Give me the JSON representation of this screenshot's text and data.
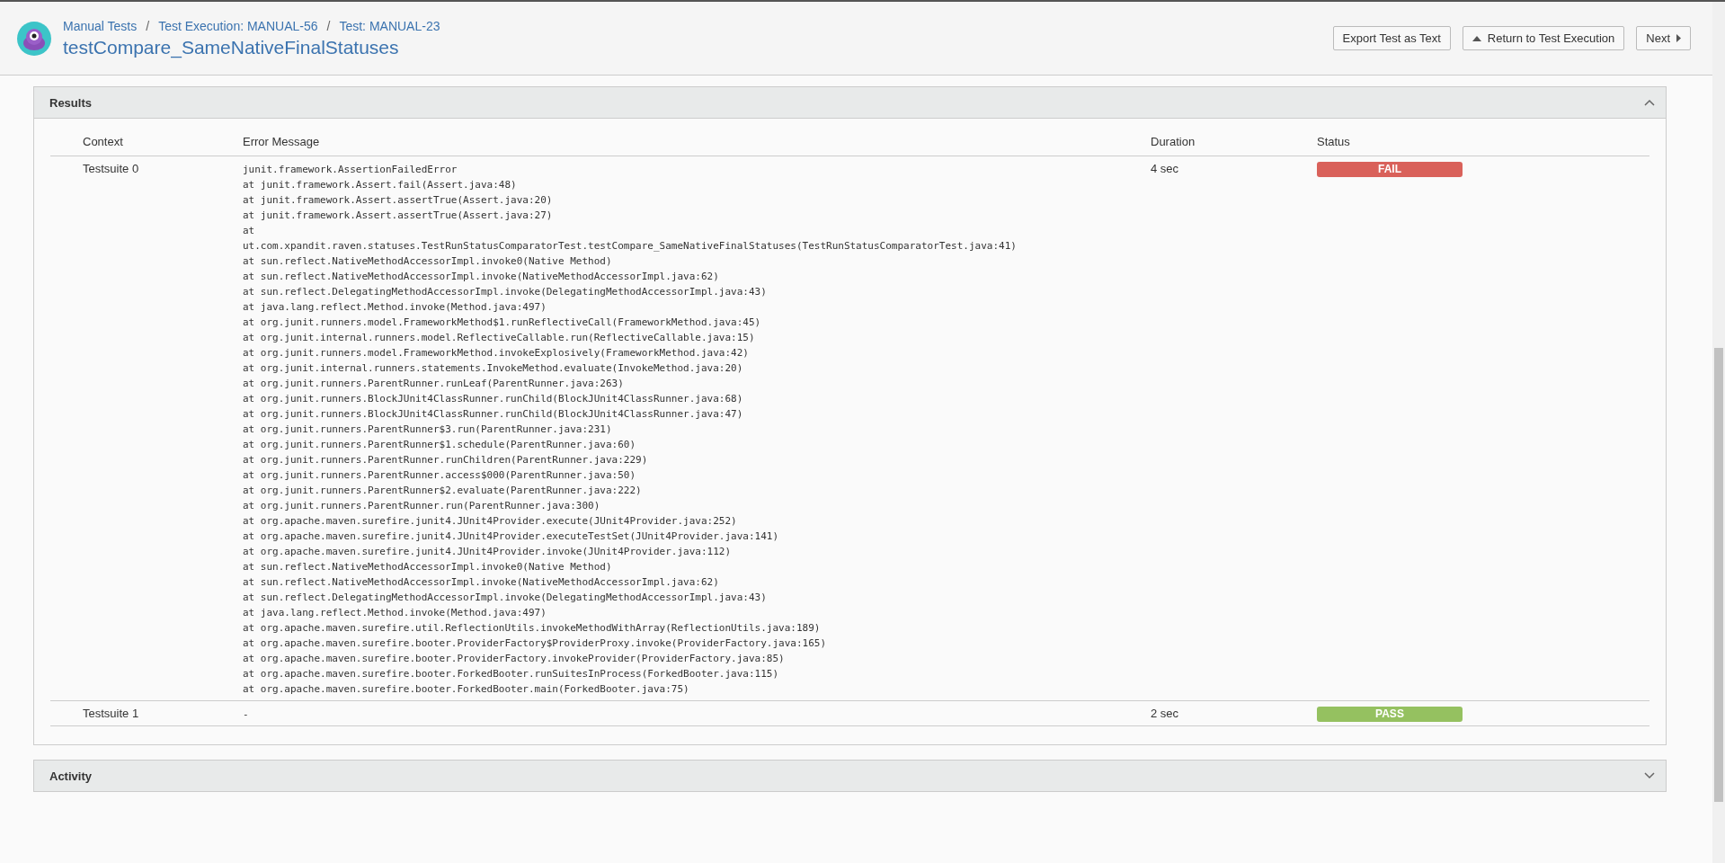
{
  "breadcrumbs": [
    "Manual Tests",
    "Test Execution: MANUAL-56",
    "Test: MANUAL-23"
  ],
  "breadcrumb_separator": "/",
  "title": "testCompare_SameNativeFinalStatuses",
  "buttons": [
    {
      "label": "Export Test as Text",
      "kind": "plain"
    },
    {
      "label": "Return to Test Execution",
      "kind": "up"
    },
    {
      "label": "Next",
      "kind": "next"
    }
  ],
  "results": {
    "title": "Results",
    "expanded": true,
    "columns": [
      "Context",
      "Error Message",
      "Duration",
      "Status"
    ],
    "rows": [
      {
        "context": "Testsuite 0",
        "error_lines": [
          "junit.framework.AssertionFailedError",
          "at junit.framework.Assert.fail(Assert.java:48)",
          "at junit.framework.Assert.assertTrue(Assert.java:20)",
          "at junit.framework.Assert.assertTrue(Assert.java:27)",
          "at",
          "ut.com.xpandit.raven.statuses.TestRunStatusComparatorTest.testCompare_SameNativeFinalStatuses(TestRunStatusComparatorTest.java:41)",
          "at sun.reflect.NativeMethodAccessorImpl.invoke0(Native Method)",
          "at sun.reflect.NativeMethodAccessorImpl.invoke(NativeMethodAccessorImpl.java:62)",
          "at sun.reflect.DelegatingMethodAccessorImpl.invoke(DelegatingMethodAccessorImpl.java:43)",
          "at java.lang.reflect.Method.invoke(Method.java:497)",
          "at org.junit.runners.model.FrameworkMethod$1.runReflectiveCall(FrameworkMethod.java:45)",
          "at org.junit.internal.runners.model.ReflectiveCallable.run(ReflectiveCallable.java:15)",
          "at org.junit.runners.model.FrameworkMethod.invokeExplosively(FrameworkMethod.java:42)",
          "at org.junit.internal.runners.statements.InvokeMethod.evaluate(InvokeMethod.java:20)",
          "at org.junit.runners.ParentRunner.runLeaf(ParentRunner.java:263)",
          "at org.junit.runners.BlockJUnit4ClassRunner.runChild(BlockJUnit4ClassRunner.java:68)",
          "at org.junit.runners.BlockJUnit4ClassRunner.runChild(BlockJUnit4ClassRunner.java:47)",
          "at org.junit.runners.ParentRunner$3.run(ParentRunner.java:231)",
          "at org.junit.runners.ParentRunner$1.schedule(ParentRunner.java:60)",
          "at org.junit.runners.ParentRunner.runChildren(ParentRunner.java:229)",
          "at org.junit.runners.ParentRunner.access$000(ParentRunner.java:50)",
          "at org.junit.runners.ParentRunner$2.evaluate(ParentRunner.java:222)",
          "at org.junit.runners.ParentRunner.run(ParentRunner.java:300)",
          "at org.apache.maven.surefire.junit4.JUnit4Provider.execute(JUnit4Provider.java:252)",
          "at org.apache.maven.surefire.junit4.JUnit4Provider.executeTestSet(JUnit4Provider.java:141)",
          "at org.apache.maven.surefire.junit4.JUnit4Provider.invoke(JUnit4Provider.java:112)",
          "at sun.reflect.NativeMethodAccessorImpl.invoke0(Native Method)",
          "at sun.reflect.NativeMethodAccessorImpl.invoke(NativeMethodAccessorImpl.java:62)",
          "at sun.reflect.DelegatingMethodAccessorImpl.invoke(DelegatingMethodAccessorImpl.java:43)",
          "at java.lang.reflect.Method.invoke(Method.java:497)",
          "at org.apache.maven.surefire.util.ReflectionUtils.invokeMethodWithArray(ReflectionUtils.java:189)",
          "at org.apache.maven.surefire.booter.ProviderFactory$ProviderProxy.invoke(ProviderFactory.java:165)",
          "at org.apache.maven.surefire.booter.ProviderFactory.invokeProvider(ProviderFactory.java:85)",
          "at org.apache.maven.surefire.booter.ForkedBooter.runSuitesInProcess(ForkedBooter.java:115)",
          "at org.apache.maven.surefire.booter.ForkedBooter.main(ForkedBooter.java:75)"
        ],
        "duration": "4 sec",
        "status": "FAIL",
        "color": "#d9615a"
      },
      {
        "context": "Testsuite 1",
        "error_lines": [
          "-"
        ],
        "duration": "2 sec",
        "status": "PASS",
        "color": "#95c160"
      }
    ]
  },
  "activity": {
    "title": "Activity",
    "expanded": false
  }
}
